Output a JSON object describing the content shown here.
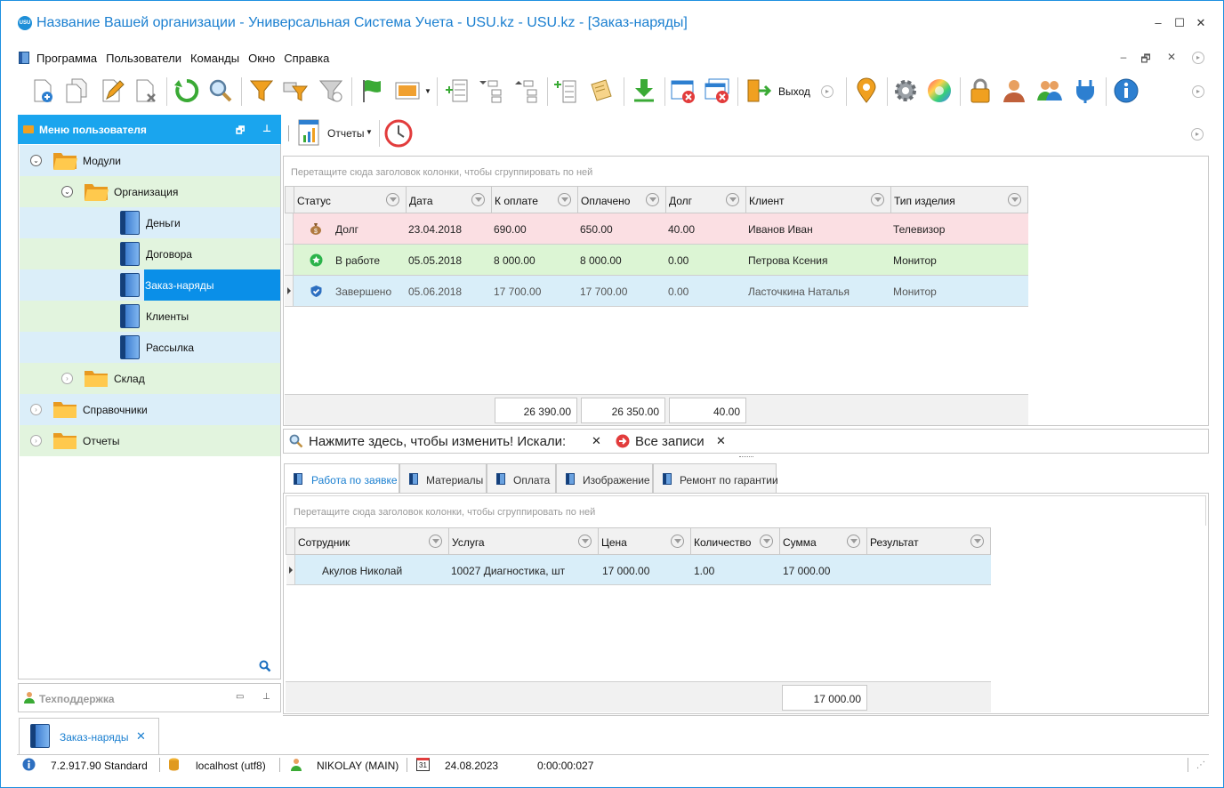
{
  "window": {
    "title": "Название Вашей организации - Универсальная Система Учета - USU.kz - USU.kz - [Заказ-наряды]",
    "logo_text": "USU",
    "minimize": "–",
    "maximize": "☐",
    "close": "✕"
  },
  "menu": {
    "items": [
      "Программа",
      "Пользователи",
      "Команды",
      "Окно",
      "Справка"
    ],
    "mdi_restore": "🗗",
    "mdi_minimize": "–",
    "mdi_close": "✕"
  },
  "toolbar": {
    "exit_label": "Выход",
    "icons": [
      "add-icon",
      "copy-icon",
      "edit-icon",
      "delete-icon",
      "refresh-icon",
      "search-icon",
      "filter-icon",
      "filter-setup-icon",
      "filter-clear-icon",
      "flag-icon",
      "image-icon",
      "expand-icon",
      "tree-collapse-icon",
      "tree-expand-icon",
      "add-row-icon",
      "notes-icon",
      "download-icon",
      "close-window-icon",
      "close-all-windows-icon",
      "exit-icon",
      "location-icon",
      "settings-icon",
      "color-wheel-icon",
      "lock-icon",
      "user-icon",
      "users-icon",
      "plugin-icon",
      "info-icon"
    ],
    "colors": {
      "green": "#3aaa35",
      "blue": "#2d7fd0",
      "orange": "#f0a020",
      "red": "#e23c3c"
    }
  },
  "left_panel": {
    "title": "Меню пользователя",
    "tree": [
      {
        "label": "Модули",
        "level": 0,
        "kind": "folder",
        "expanded": true
      },
      {
        "label": "Организация",
        "level": 1,
        "kind": "folder",
        "expanded": true
      },
      {
        "label": "Деньги",
        "level": 2,
        "kind": "module"
      },
      {
        "label": "Договора",
        "level": 2,
        "kind": "module"
      },
      {
        "label": "Заказ-наряды",
        "level": 2,
        "kind": "module",
        "selected": true
      },
      {
        "label": "Клиенты",
        "level": 2,
        "kind": "module"
      },
      {
        "label": "Рассылка",
        "level": 2,
        "kind": "module"
      },
      {
        "label": "Склад",
        "level": 1,
        "kind": "folder",
        "expanded": false
      },
      {
        "label": "Справочники",
        "level": 0,
        "kind": "folder",
        "expanded": false
      },
      {
        "label": "Отчеты",
        "level": 0,
        "kind": "folder",
        "expanded": false
      }
    ],
    "support_title": "Техподдержка"
  },
  "reports": {
    "label": "Отчеты"
  },
  "main_grid": {
    "group_hint": "Перетащите сюда заголовок колонки, чтобы сгруппировать по ней",
    "columns": [
      "Статус",
      "Дата",
      "К оплате",
      "Оплачено",
      "Долг",
      "Клиент",
      "Тип изделия"
    ],
    "rows": [
      {
        "status": "Долг",
        "date": "23.04.2018",
        "to_pay": "690.00",
        "paid": "650.00",
        "debt": "40.00",
        "client": "Иванов Иван",
        "product": "Телевизор",
        "color": "#fbdfe3",
        "status_icon": "money-bag-icon"
      },
      {
        "status": "В работе",
        "date": "05.05.2018",
        "to_pay": "8 000.00",
        "paid": "8 000.00",
        "debt": "0.00",
        "client": "Петрова Ксения",
        "product": "Монитор",
        "color": "#dcf5d4",
        "status_icon": "star-icon"
      },
      {
        "status": "Завершено",
        "date": "05.06.2018",
        "to_pay": "17 700.00",
        "paid": "17 700.00",
        "debt": "0.00",
        "client": "Ласточкина Наталья",
        "product": "Монитор",
        "color": "#d9eef9",
        "status_icon": "check-icon"
      }
    ],
    "totals": {
      "to_pay": "26 390.00",
      "paid": "26 350.00",
      "debt": "40.00"
    }
  },
  "find_bar": {
    "text": "Нажмите здесь, чтобы изменить! Искали:",
    "clear": "✕",
    "all_records": "Все записи"
  },
  "detail_tabs": [
    "Работа по заявке",
    "Материалы",
    "Оплата",
    "Изображение",
    "Ремонт по гарантии"
  ],
  "detail_grid": {
    "group_hint": "Перетащите сюда заголовок колонки, чтобы сгруппировать по ней",
    "columns": [
      "Сотрудник",
      "Услуга",
      "Цена",
      "Количество",
      "Сумма",
      "Результат"
    ],
    "rows": [
      {
        "employee": "Акулов Николай",
        "service": "10027 Диагностика, шт",
        "price": "17 000.00",
        "qty": "1.00",
        "sum": "17 000.00",
        "result": ""
      }
    ],
    "total": "17 000.00"
  },
  "doc_tab": {
    "label": "Заказ-наряды",
    "close": "✕"
  },
  "status_bar": {
    "version": "7.2.917.90 Standard",
    "db": "localhost (utf8)",
    "user": "NIKOLAY (MAIN)",
    "calendar_day": "31",
    "date": "24.08.2023",
    "timer": "0:00:00:027"
  }
}
